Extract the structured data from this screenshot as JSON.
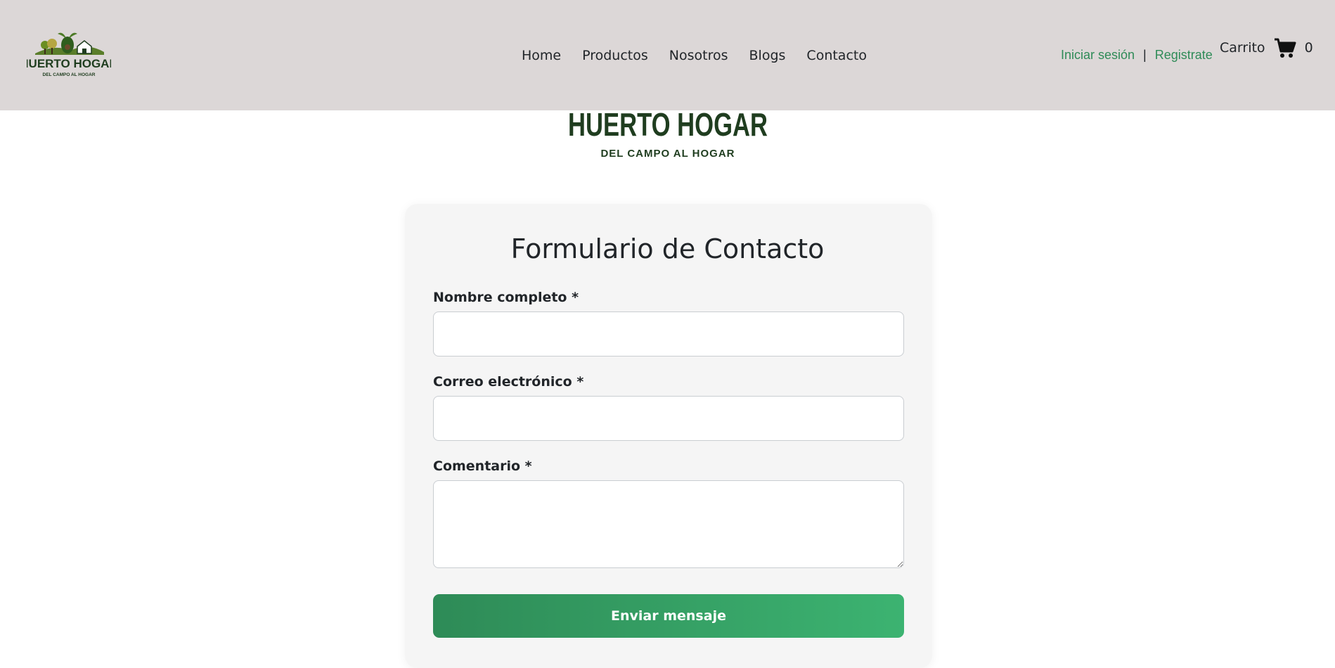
{
  "brand": {
    "logo_text": "HUERTO HOGAR",
    "tagline": "DEL CAMPO AL HOGAR"
  },
  "nav": {
    "links": [
      "Home",
      "Productos",
      "Nosotros",
      "Blogs",
      "Contacto"
    ]
  },
  "auth": {
    "login": "Iniciar sesión",
    "separator": "|",
    "register": "Registrate"
  },
  "cart": {
    "label": "Carrito",
    "count": "0",
    "icon": "cart-icon"
  },
  "form": {
    "title": "Formulario de Contacto",
    "name_label": "Nombre completo *",
    "name_value": "",
    "email_label": "Correo electrónico *",
    "email_value": "",
    "comment_label": "Comentario *",
    "comment_value": "",
    "submit_label": "Enviar mensaje"
  },
  "colors": {
    "navbar_bg": "#dcd7d7",
    "accent_green": "#2e8b57",
    "logo_dark_green": "#1f3d1f",
    "card_bg": "#f5f5f5"
  }
}
